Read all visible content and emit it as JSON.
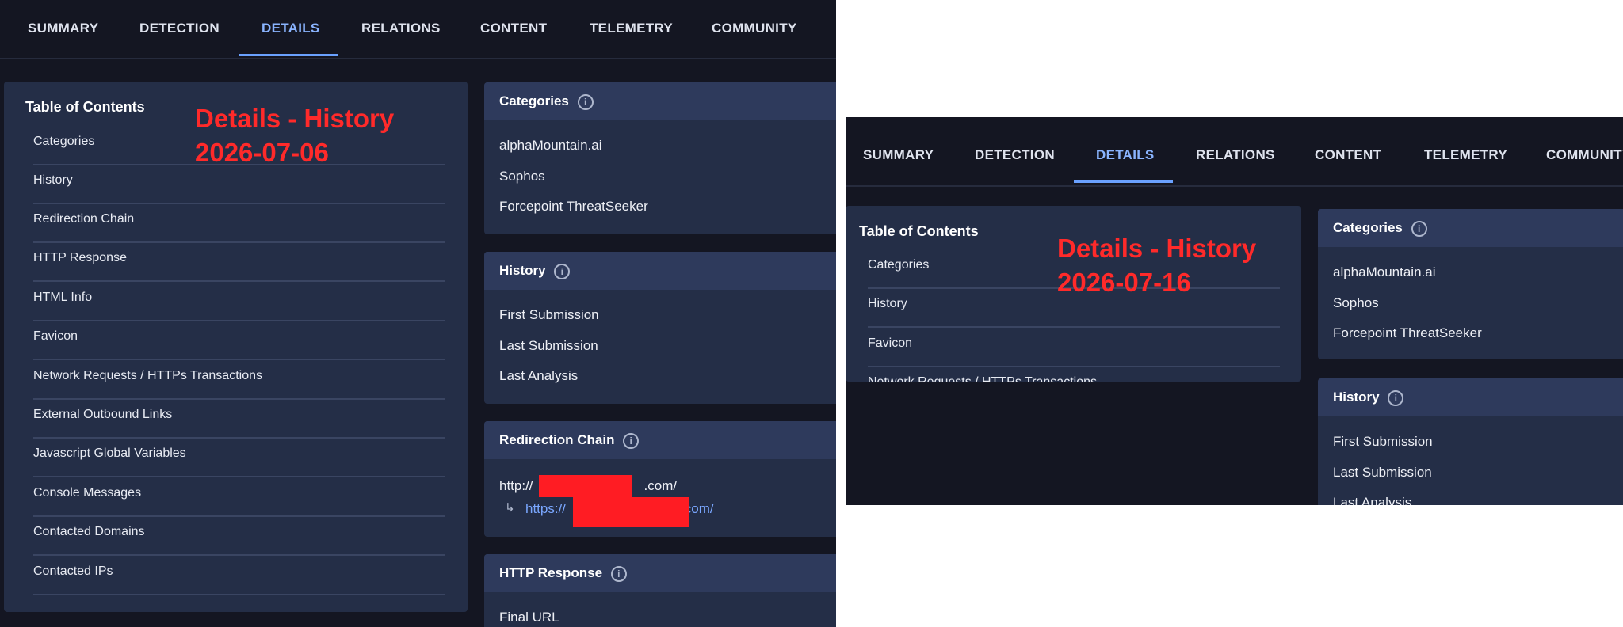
{
  "tabs": [
    "SUMMARY",
    "DETECTION",
    "DETAILS",
    "RELATIONS",
    "CONTENT",
    "TELEMETRY",
    "COMMUNITY"
  ],
  "active_tab": "DETAILS",
  "left_view": {
    "annotation": {
      "line1": "Details - History",
      "line2": "2026-07-06"
    },
    "toc": {
      "title": "Table of Contents",
      "items": [
        "Categories",
        "History",
        "Redirection Chain",
        "HTTP Response",
        "HTML Info",
        "Favicon",
        "Network Requests / HTTPs Transactions",
        "External Outbound Links",
        "Javascript Global Variables",
        "Console Messages",
        "Contacted Domains",
        "Contacted IPs"
      ]
    },
    "sections": {
      "categories": {
        "title": "Categories",
        "rows": [
          "alphaMountain.ai",
          "Sophos",
          "Forcepoint ThreatSeeker"
        ]
      },
      "history": {
        "title": "History",
        "rows": [
          "First Submission",
          "Last Submission",
          "Last Analysis"
        ]
      },
      "redirection": {
        "title": "Redirection Chain",
        "url1_prefix": "http://",
        "url1_suffix": ".com/",
        "url2_prefix": "https://",
        "url2_suffix": ".com/"
      },
      "http_response": {
        "title": "HTTP Response",
        "rows": [
          "Final URL"
        ]
      }
    }
  },
  "right_view": {
    "annotation": {
      "line1": "Details - History",
      "line2": "2026-07-16"
    },
    "toc": {
      "title": "Table of Contents",
      "items": [
        "Categories",
        "History",
        "Favicon",
        "Network Requests / HTTPs Transactions"
      ]
    },
    "sections": {
      "categories": {
        "title": "Categories",
        "rows": [
          "alphaMountain.ai",
          "Sophos",
          "Forcepoint ThreatSeeker"
        ]
      },
      "history": {
        "title": "History",
        "rows": [
          "First Submission",
          "Last Submission",
          "Last Analysis"
        ]
      }
    }
  },
  "icons": {
    "info": "info-circle-icon",
    "redirect_arrow": "return-arrow-icon"
  },
  "colors": {
    "annotation": "#ff2a2a",
    "active_tab": "#8ab4ff",
    "redaction": "#ff1c23",
    "link": "#7aa7ff"
  }
}
